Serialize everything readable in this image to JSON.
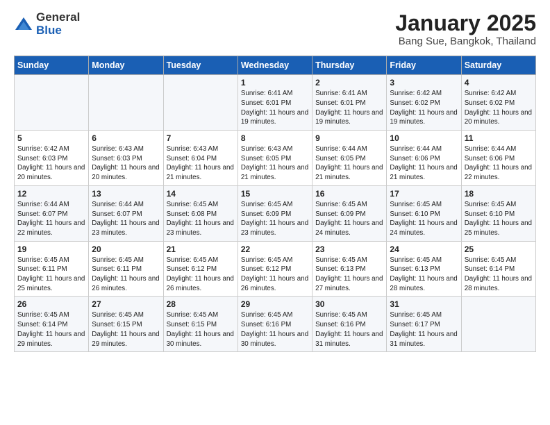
{
  "logo": {
    "general": "General",
    "blue": "Blue"
  },
  "title": "January 2025",
  "subtitle": "Bang Sue, Bangkok, Thailand",
  "weekdays": [
    "Sunday",
    "Monday",
    "Tuesday",
    "Wednesday",
    "Thursday",
    "Friday",
    "Saturday"
  ],
  "weeks": [
    [
      {
        "day": "",
        "sunrise": "",
        "sunset": "",
        "daylight": ""
      },
      {
        "day": "",
        "sunrise": "",
        "sunset": "",
        "daylight": ""
      },
      {
        "day": "",
        "sunrise": "",
        "sunset": "",
        "daylight": ""
      },
      {
        "day": "1",
        "sunrise": "Sunrise: 6:41 AM",
        "sunset": "Sunset: 6:01 PM",
        "daylight": "Daylight: 11 hours and 19 minutes."
      },
      {
        "day": "2",
        "sunrise": "Sunrise: 6:41 AM",
        "sunset": "Sunset: 6:01 PM",
        "daylight": "Daylight: 11 hours and 19 minutes."
      },
      {
        "day": "3",
        "sunrise": "Sunrise: 6:42 AM",
        "sunset": "Sunset: 6:02 PM",
        "daylight": "Daylight: 11 hours and 19 minutes."
      },
      {
        "day": "4",
        "sunrise": "Sunrise: 6:42 AM",
        "sunset": "Sunset: 6:02 PM",
        "daylight": "Daylight: 11 hours and 20 minutes."
      }
    ],
    [
      {
        "day": "5",
        "sunrise": "Sunrise: 6:42 AM",
        "sunset": "Sunset: 6:03 PM",
        "daylight": "Daylight: 11 hours and 20 minutes."
      },
      {
        "day": "6",
        "sunrise": "Sunrise: 6:43 AM",
        "sunset": "Sunset: 6:03 PM",
        "daylight": "Daylight: 11 hours and 20 minutes."
      },
      {
        "day": "7",
        "sunrise": "Sunrise: 6:43 AM",
        "sunset": "Sunset: 6:04 PM",
        "daylight": "Daylight: 11 hours and 21 minutes."
      },
      {
        "day": "8",
        "sunrise": "Sunrise: 6:43 AM",
        "sunset": "Sunset: 6:05 PM",
        "daylight": "Daylight: 11 hours and 21 minutes."
      },
      {
        "day": "9",
        "sunrise": "Sunrise: 6:44 AM",
        "sunset": "Sunset: 6:05 PM",
        "daylight": "Daylight: 11 hours and 21 minutes."
      },
      {
        "day": "10",
        "sunrise": "Sunrise: 6:44 AM",
        "sunset": "Sunset: 6:06 PM",
        "daylight": "Daylight: 11 hours and 21 minutes."
      },
      {
        "day": "11",
        "sunrise": "Sunrise: 6:44 AM",
        "sunset": "Sunset: 6:06 PM",
        "daylight": "Daylight: 11 hours and 22 minutes."
      }
    ],
    [
      {
        "day": "12",
        "sunrise": "Sunrise: 6:44 AM",
        "sunset": "Sunset: 6:07 PM",
        "daylight": "Daylight: 11 hours and 22 minutes."
      },
      {
        "day": "13",
        "sunrise": "Sunrise: 6:44 AM",
        "sunset": "Sunset: 6:07 PM",
        "daylight": "Daylight: 11 hours and 23 minutes."
      },
      {
        "day": "14",
        "sunrise": "Sunrise: 6:45 AM",
        "sunset": "Sunset: 6:08 PM",
        "daylight": "Daylight: 11 hours and 23 minutes."
      },
      {
        "day": "15",
        "sunrise": "Sunrise: 6:45 AM",
        "sunset": "Sunset: 6:09 PM",
        "daylight": "Daylight: 11 hours and 23 minutes."
      },
      {
        "day": "16",
        "sunrise": "Sunrise: 6:45 AM",
        "sunset": "Sunset: 6:09 PM",
        "daylight": "Daylight: 11 hours and 24 minutes."
      },
      {
        "day": "17",
        "sunrise": "Sunrise: 6:45 AM",
        "sunset": "Sunset: 6:10 PM",
        "daylight": "Daylight: 11 hours and 24 minutes."
      },
      {
        "day": "18",
        "sunrise": "Sunrise: 6:45 AM",
        "sunset": "Sunset: 6:10 PM",
        "daylight": "Daylight: 11 hours and 25 minutes."
      }
    ],
    [
      {
        "day": "19",
        "sunrise": "Sunrise: 6:45 AM",
        "sunset": "Sunset: 6:11 PM",
        "daylight": "Daylight: 11 hours and 25 minutes."
      },
      {
        "day": "20",
        "sunrise": "Sunrise: 6:45 AM",
        "sunset": "Sunset: 6:11 PM",
        "daylight": "Daylight: 11 hours and 26 minutes."
      },
      {
        "day": "21",
        "sunrise": "Sunrise: 6:45 AM",
        "sunset": "Sunset: 6:12 PM",
        "daylight": "Daylight: 11 hours and 26 minutes."
      },
      {
        "day": "22",
        "sunrise": "Sunrise: 6:45 AM",
        "sunset": "Sunset: 6:12 PM",
        "daylight": "Daylight: 11 hours and 26 minutes."
      },
      {
        "day": "23",
        "sunrise": "Sunrise: 6:45 AM",
        "sunset": "Sunset: 6:13 PM",
        "daylight": "Daylight: 11 hours and 27 minutes."
      },
      {
        "day": "24",
        "sunrise": "Sunrise: 6:45 AM",
        "sunset": "Sunset: 6:13 PM",
        "daylight": "Daylight: 11 hours and 28 minutes."
      },
      {
        "day": "25",
        "sunrise": "Sunrise: 6:45 AM",
        "sunset": "Sunset: 6:14 PM",
        "daylight": "Daylight: 11 hours and 28 minutes."
      }
    ],
    [
      {
        "day": "26",
        "sunrise": "Sunrise: 6:45 AM",
        "sunset": "Sunset: 6:14 PM",
        "daylight": "Daylight: 11 hours and 29 minutes."
      },
      {
        "day": "27",
        "sunrise": "Sunrise: 6:45 AM",
        "sunset": "Sunset: 6:15 PM",
        "daylight": "Daylight: 11 hours and 29 minutes."
      },
      {
        "day": "28",
        "sunrise": "Sunrise: 6:45 AM",
        "sunset": "Sunset: 6:15 PM",
        "daylight": "Daylight: 11 hours and 30 minutes."
      },
      {
        "day": "29",
        "sunrise": "Sunrise: 6:45 AM",
        "sunset": "Sunset: 6:16 PM",
        "daylight": "Daylight: 11 hours and 30 minutes."
      },
      {
        "day": "30",
        "sunrise": "Sunrise: 6:45 AM",
        "sunset": "Sunset: 6:16 PM",
        "daylight": "Daylight: 11 hours and 31 minutes."
      },
      {
        "day": "31",
        "sunrise": "Sunrise: 6:45 AM",
        "sunset": "Sunset: 6:17 PM",
        "daylight": "Daylight: 11 hours and 31 minutes."
      },
      {
        "day": "",
        "sunrise": "",
        "sunset": "",
        "daylight": ""
      }
    ]
  ]
}
